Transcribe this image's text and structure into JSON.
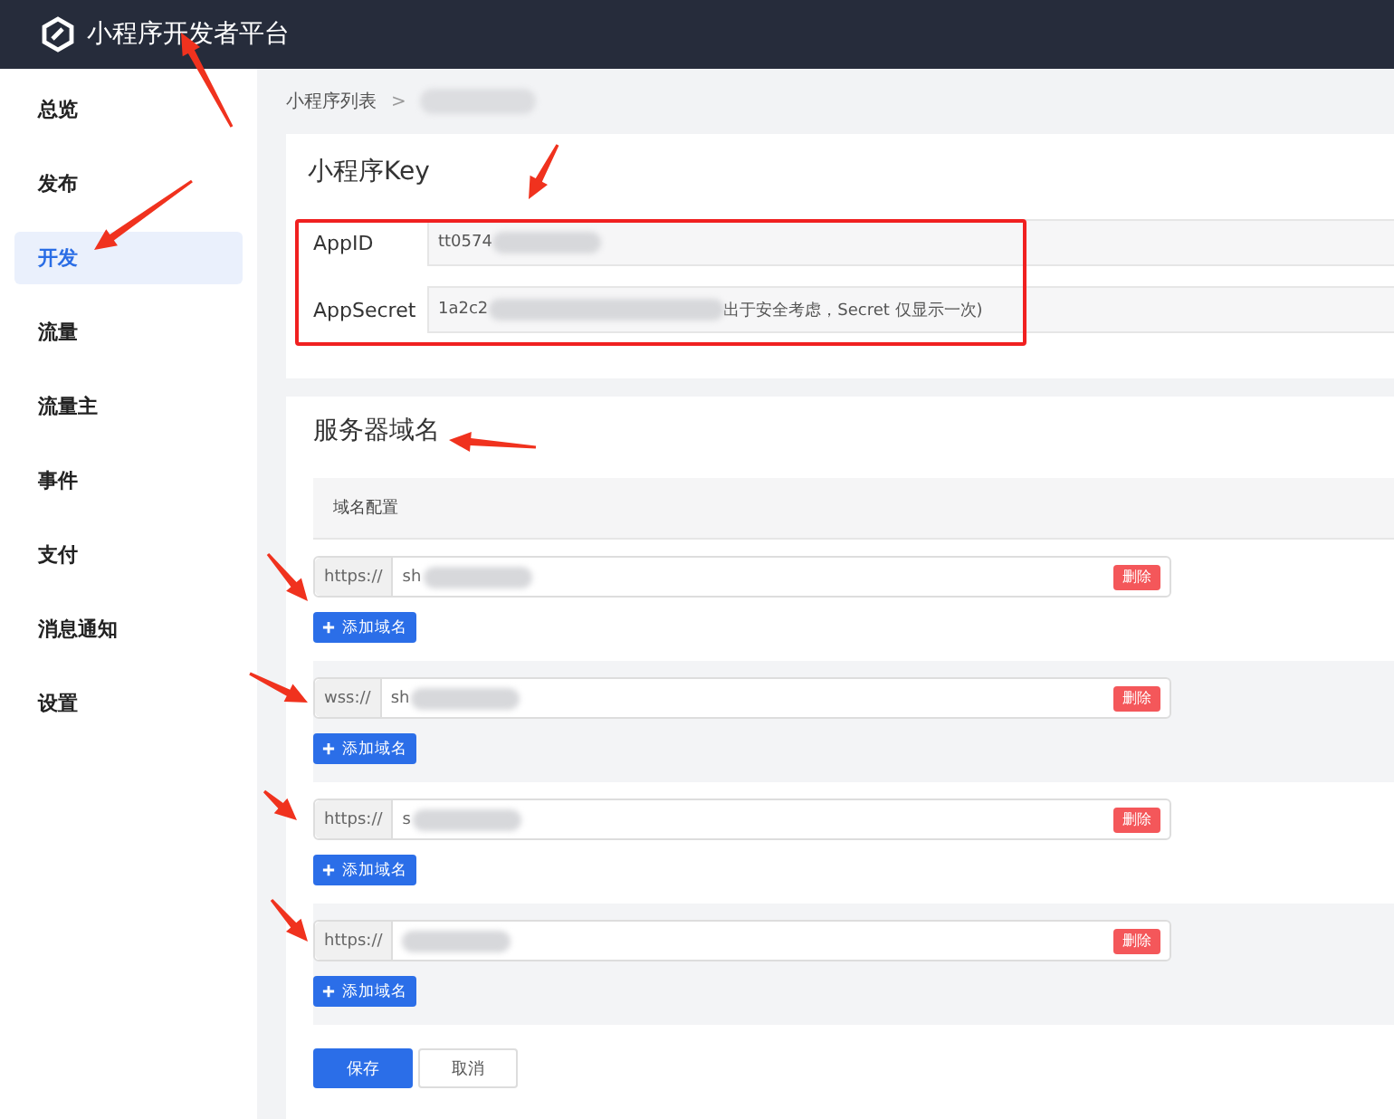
{
  "header": {
    "title": "小程序开发者平台"
  },
  "sidebar": {
    "items": [
      {
        "label": "总览",
        "selected": false
      },
      {
        "label": "发布",
        "selected": false
      },
      {
        "label": "开发",
        "selected": true
      },
      {
        "label": "流量",
        "selected": false
      },
      {
        "label": "流量主",
        "selected": false
      },
      {
        "label": "事件",
        "selected": false
      },
      {
        "label": "支付",
        "selected": false
      },
      {
        "label": "消息通知",
        "selected": false
      },
      {
        "label": "设置",
        "selected": false
      }
    ]
  },
  "breadcrumb": {
    "items": [
      "小程序列表"
    ],
    "separator": ">"
  },
  "key_card": {
    "title": "小程序Key",
    "rows": [
      {
        "label": "AppID",
        "value": "tt0574",
        "note": ""
      },
      {
        "label": "AppSecret",
        "value": "1a2c2",
        "note": "出于安全考虑，Secret 仅显示一次)"
      }
    ]
  },
  "domain_card": {
    "title": "服务器域名",
    "section": "域名配置",
    "groups": [
      {
        "prefix": "https://",
        "value": "sh",
        "delete": "删除",
        "add": "添加域名"
      },
      {
        "prefix": "wss://",
        "value": "sh",
        "delete": "删除",
        "add": "添加域名"
      },
      {
        "prefix": "https://",
        "value": "s",
        "delete": "删除",
        "add": "添加域名"
      },
      {
        "prefix": "https://",
        "delete": "删除",
        "add": "添加域名"
      }
    ],
    "buttons": [
      {
        "label": "保存",
        "kind": "primary"
      },
      {
        "label": "取消",
        "kind": "default"
      }
    ]
  }
}
